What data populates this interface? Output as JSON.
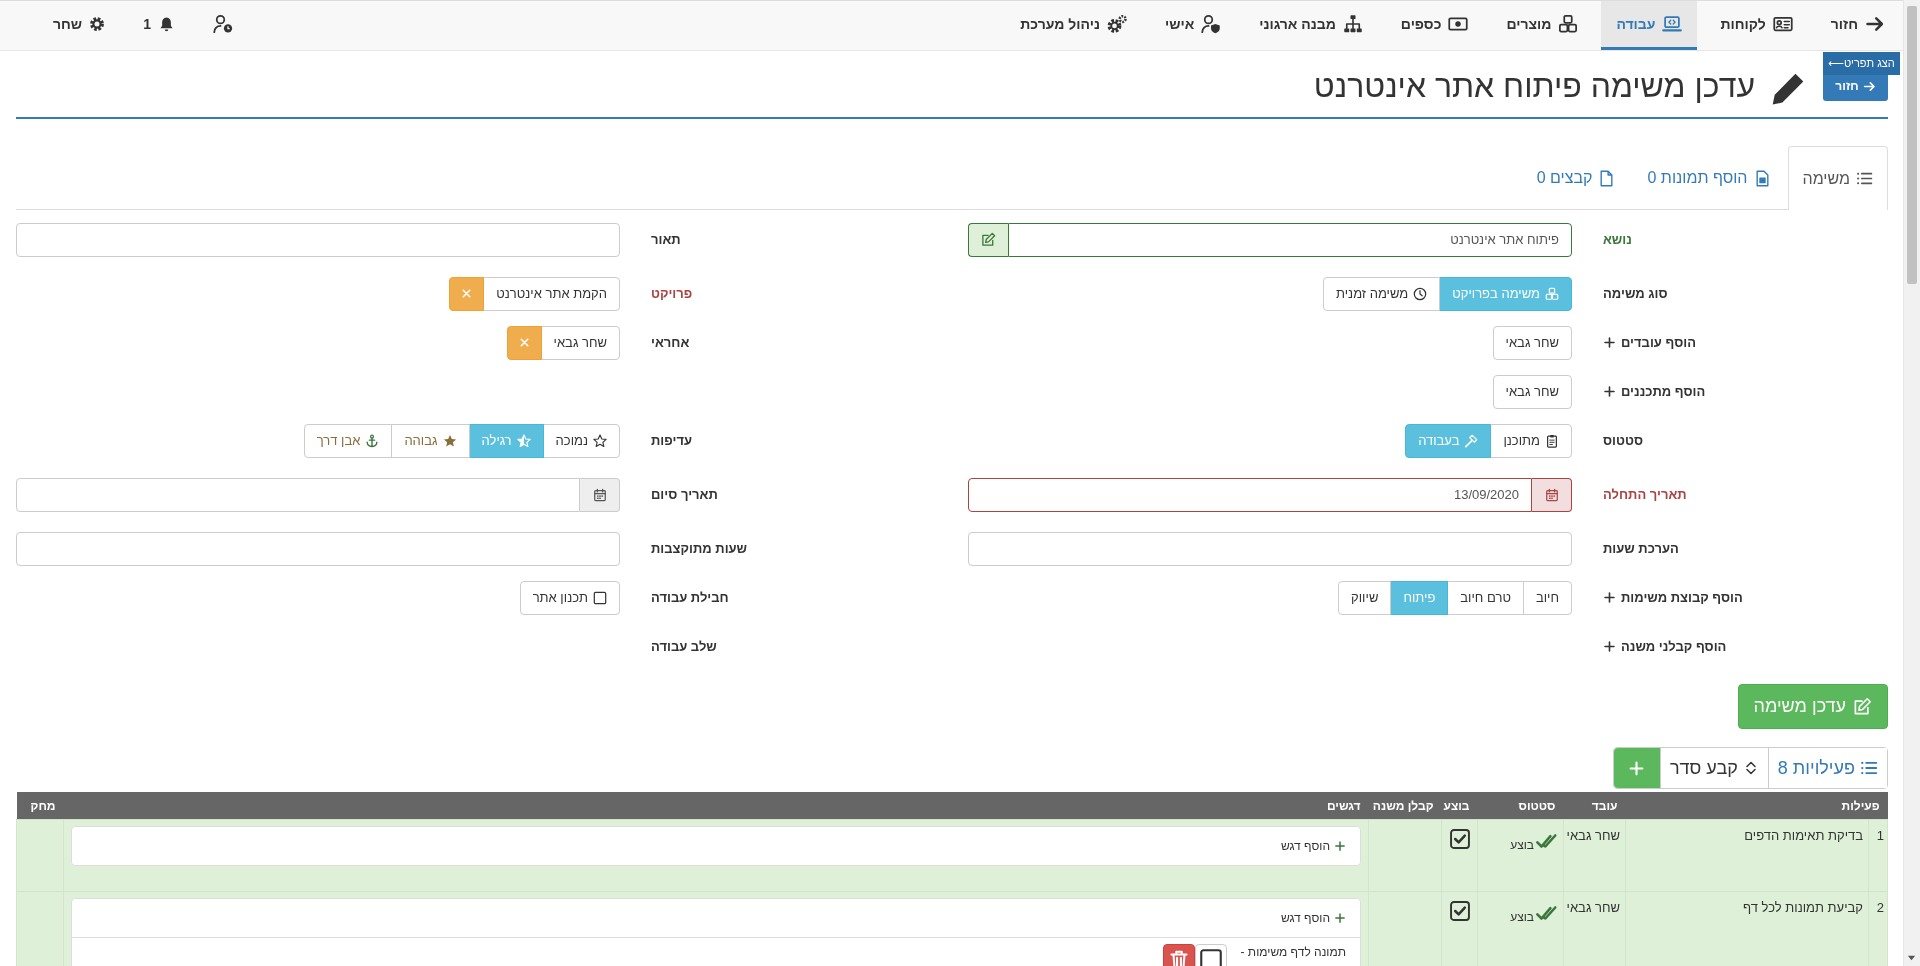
{
  "nav": {
    "items": [
      {
        "label": "חזור",
        "kind": "back",
        "selected": false
      },
      {
        "label": "לקוחות",
        "kind": "customers",
        "selected": false
      },
      {
        "label": "עבודה",
        "kind": "work",
        "selected": true
      },
      {
        "label": "מוצרים",
        "kind": "products",
        "selected": false
      },
      {
        "label": "כספים",
        "kind": "finance",
        "selected": false
      },
      {
        "label": "מבנה ארגוני",
        "kind": "org",
        "selected": false
      },
      {
        "label": "אישי",
        "kind": "personal",
        "selected": false
      },
      {
        "label": "ניהול מערכת",
        "kind": "admin",
        "selected": false
      }
    ],
    "notifications": "1",
    "user": "שחר"
  },
  "header": {
    "menu_button": "הצג תפריט⟵",
    "back_button": "חזור",
    "title": "עדכן משימה פיתוח אתר אינטרנט"
  },
  "tabs": [
    {
      "label": "משימה",
      "kind": "task",
      "selected": true
    },
    {
      "label": "הוסף תמונות 0",
      "kind": "images",
      "selected": false
    },
    {
      "label": "קבצים 0",
      "kind": "files",
      "selected": false
    }
  ],
  "form": {
    "rows": [
      {
        "right": {
          "label": "נושא",
          "valid": true,
          "error": false,
          "kind": "text_button",
          "value": "פיתוח אתר אינטרנט"
        },
        "left": {
          "label": "תאור",
          "valid": false,
          "error": false,
          "kind": "text"
        }
      },
      {
        "right": {
          "label": "סוג משימה",
          "valid": false,
          "error": false,
          "kind": "buttons",
          "options": [
            {
              "label": "משימה בפרויקט",
              "kind": "project",
              "selected": true
            },
            {
              "label": "משימה זמנית",
              "kind": "temporary",
              "selected": false
            }
          ]
        },
        "left": {
          "label": "פרויקט",
          "valid": false,
          "error": true,
          "kind": "removable",
          "value": "הקמת אתר אינטרנט"
        }
      },
      {
        "right": {
          "label": "הוסף עובדים",
          "add": true,
          "kind": "tags",
          "tags": [
            "שחר גבאי"
          ]
        },
        "left": {
          "label": "אחראי",
          "kind": "removable",
          "value": "שחר גבאי"
        }
      },
      {
        "right": {
          "label": "הוסף מתכננים",
          "add": true,
          "kind": "tags",
          "tags": [
            "שחר גבאי"
          ]
        }
      },
      {
        "right": {
          "label": "סטטוס",
          "kind": "buttons",
          "options": [
            {
              "label": "מתוכנן",
              "kind": "planned",
              "selected": false
            },
            {
              "label": "בעבודה",
              "kind": "in_progress",
              "selected": true
            }
          ]
        },
        "left": {
          "label": "עדיפות",
          "kind": "buttons",
          "options": [
            {
              "label": "נמוכה",
              "kind": "low",
              "selected": false
            },
            {
              "label": "רגילה",
              "kind": "normal",
              "selected": true
            },
            {
              "label": "גבוהה",
              "kind": "high",
              "selected": false
            },
            {
              "label": "אבן דרך",
              "kind": "milestone",
              "selected": false
            }
          ]
        }
      },
      {
        "right": {
          "label": "תאריך התחלה",
          "valid": false,
          "error": true,
          "kind": "date",
          "value": "13/09/2020"
        },
        "left": {
          "label": "תאריך סיום",
          "valid": false,
          "error": false,
          "kind": "date"
        }
      },
      {
        "right": {
          "label": "הערכת שעות",
          "kind": "text"
        },
        "left": {
          "label": "שעות מתוקצבות",
          "kind": "text"
        }
      },
      {
        "right": {
          "label": "הוסף קבוצת משימות",
          "add": true,
          "kind": "buttons",
          "options": [
            {
              "label": "חיוב",
              "selected": false
            },
            {
              "label": "טרם חיוב",
              "selected": false
            },
            {
              "label": "פיתוח",
              "selected": true
            },
            {
              "label": "שיווק",
              "selected": false
            }
          ]
        },
        "left": {
          "label": "חבילת עבודה",
          "kind": "checkbox",
          "value": "תכנון אתר",
          "checked": false
        }
      },
      {
        "right": {
          "label": "הוסף קבלני משנה",
          "add": true,
          "kind": "label"
        },
        "left": {
          "label": "שלב עבודה",
          "kind": "label"
        }
      }
    ]
  },
  "submit_button": "עדכן משימה",
  "activities": {
    "label": "פעילויות 8",
    "sort_button": "קבע סדר"
  },
  "table": {
    "columns": [
      "פעילות",
      "עובד",
      "סטטוס",
      "בוצע",
      "קבלן משנה",
      "דגשים",
      "מחק"
    ],
    "rows": [
      {
        "number": "1",
        "activity": "בדיקת תאימות הדפים",
        "worker": "שחר גבאי",
        "status": "בוצע",
        "done": true,
        "add_note": "הוסף דגש"
      },
      {
        "number": "2",
        "activity": "קביעת תמונות לכל דף",
        "worker": "שחר גבאי",
        "status": "בוצע",
        "done": true,
        "add_note": "הוסף דגש",
        "notes": [
          {
            "text": "תמונה לדף משימות -",
            "checked": false
          }
        ]
      }
    ]
  }
}
